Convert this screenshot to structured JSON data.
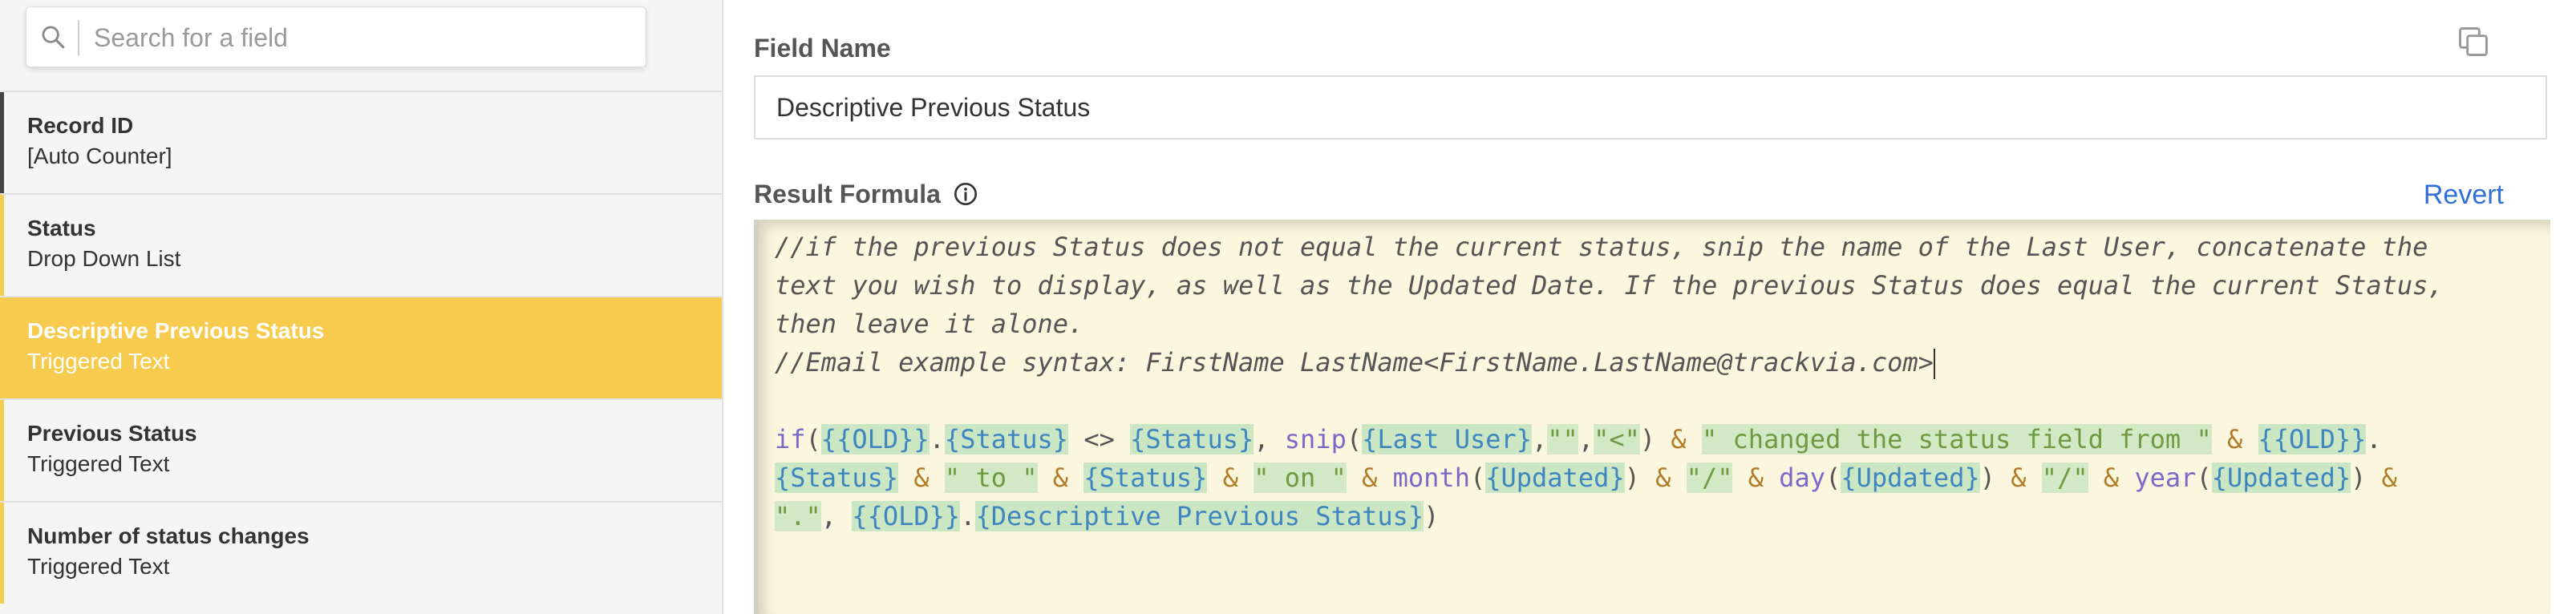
{
  "search": {
    "placeholder": "Search for a field",
    "value": ""
  },
  "fields": [
    {
      "name": "Record ID",
      "type": "[Auto Counter]",
      "accent": "#444444",
      "selected": false
    },
    {
      "name": "Status",
      "type": "Drop Down List",
      "accent": "#f7cb4d",
      "selected": false
    },
    {
      "name": "Descriptive Previous Status",
      "type": "Triggered Text",
      "accent": "#f7cb4d",
      "selected": true
    },
    {
      "name": "Previous Status",
      "type": "Triggered Text",
      "accent": "#f7cb4d",
      "selected": false
    },
    {
      "name": "Number of status changes",
      "type": "Triggered Text",
      "accent": "#f7cb4d",
      "selected": false
    }
  ],
  "editor": {
    "field_name_label": "Field Name",
    "field_name_value": "Descriptive Previous Status",
    "result_formula_label": "Result Formula",
    "revert_label": "Revert",
    "copy_icon": "copy-icon",
    "info_icon": "info-icon",
    "formula_lines": [
      [
        {
          "t": "//if the previous Status does not equal the current status, snip the name of the Last User, concatenate the",
          "k": "comment"
        }
      ],
      [
        {
          "t": "text you wish to display, as well as the Updated Date. If the previous Status does equal the current Status,",
          "k": "comment"
        }
      ],
      [
        {
          "t": "then leave it alone.",
          "k": "comment"
        }
      ],
      [
        {
          "t": "//Email example syntax: FirstName LastName<FirstName.LastName@trackvia.com>",
          "k": "comment"
        },
        {
          "t": "",
          "k": "caret"
        }
      ],
      [],
      [
        {
          "t": "if",
          "k": "fn"
        },
        {
          "t": "(",
          "k": "punct"
        },
        {
          "t": "{{OLD}}",
          "k": "ref"
        },
        {
          "t": ".",
          "k": "punct"
        },
        {
          "t": "{Status}",
          "k": "ref"
        },
        {
          "t": " <> ",
          "k": "punct"
        },
        {
          "t": "{Status}",
          "k": "ref"
        },
        {
          "t": ", ",
          "k": "punct"
        },
        {
          "t": "snip",
          "k": "fn"
        },
        {
          "t": "(",
          "k": "punct"
        },
        {
          "t": "{Last User}",
          "k": "ref"
        },
        {
          "t": ",",
          "k": "punct"
        },
        {
          "t": "\"\"",
          "k": "str"
        },
        {
          "t": ",",
          "k": "punct"
        },
        {
          "t": "\"<\"",
          "k": "str"
        },
        {
          "t": ") ",
          "k": "punct"
        },
        {
          "t": "&",
          "k": "op"
        },
        {
          "t": " ",
          "k": "punct"
        },
        {
          "t": "\" changed the status field from \"",
          "k": "str"
        },
        {
          "t": " ",
          "k": "punct"
        },
        {
          "t": "&",
          "k": "op"
        },
        {
          "t": " ",
          "k": "punct"
        },
        {
          "t": "{{OLD}}",
          "k": "ref"
        },
        {
          "t": ".",
          "k": "punct"
        }
      ],
      [
        {
          "t": "{Status}",
          "k": "ref"
        },
        {
          "t": " ",
          "k": "punct"
        },
        {
          "t": "&",
          "k": "op"
        },
        {
          "t": " ",
          "k": "punct"
        },
        {
          "t": "\" to \"",
          "k": "str"
        },
        {
          "t": " ",
          "k": "punct"
        },
        {
          "t": "&",
          "k": "op"
        },
        {
          "t": " ",
          "k": "punct"
        },
        {
          "t": "{Status}",
          "k": "ref"
        },
        {
          "t": " ",
          "k": "punct"
        },
        {
          "t": "&",
          "k": "op"
        },
        {
          "t": " ",
          "k": "punct"
        },
        {
          "t": "\" on \"",
          "k": "str"
        },
        {
          "t": " ",
          "k": "punct"
        },
        {
          "t": "&",
          "k": "op"
        },
        {
          "t": " ",
          "k": "punct"
        },
        {
          "t": "month",
          "k": "fn"
        },
        {
          "t": "(",
          "k": "punct"
        },
        {
          "t": "{Updated}",
          "k": "ref"
        },
        {
          "t": ") ",
          "k": "punct"
        },
        {
          "t": "&",
          "k": "op"
        },
        {
          "t": " ",
          "k": "punct"
        },
        {
          "t": "\"/\"",
          "k": "str"
        },
        {
          "t": " ",
          "k": "punct"
        },
        {
          "t": "&",
          "k": "op"
        },
        {
          "t": " ",
          "k": "punct"
        },
        {
          "t": "day",
          "k": "fn"
        },
        {
          "t": "(",
          "k": "punct"
        },
        {
          "t": "{Updated}",
          "k": "ref"
        },
        {
          "t": ") ",
          "k": "punct"
        },
        {
          "t": "&",
          "k": "op"
        },
        {
          "t": " ",
          "k": "punct"
        },
        {
          "t": "\"/\"",
          "k": "str"
        },
        {
          "t": " ",
          "k": "punct"
        },
        {
          "t": "&",
          "k": "op"
        },
        {
          "t": " ",
          "k": "punct"
        },
        {
          "t": "year",
          "k": "fn"
        },
        {
          "t": "(",
          "k": "punct"
        },
        {
          "t": "{Updated}",
          "k": "ref"
        },
        {
          "t": ") ",
          "k": "punct"
        },
        {
          "t": "&",
          "k": "op"
        }
      ],
      [
        {
          "t": "\".\"",
          "k": "str"
        },
        {
          "t": ", ",
          "k": "punct"
        },
        {
          "t": "{{OLD}}",
          "k": "ref"
        },
        {
          "t": ".",
          "k": "punct"
        },
        {
          "t": "{Descriptive Previous Status}",
          "k": "ref"
        },
        {
          "t": ")",
          "k": "punct"
        }
      ]
    ]
  }
}
